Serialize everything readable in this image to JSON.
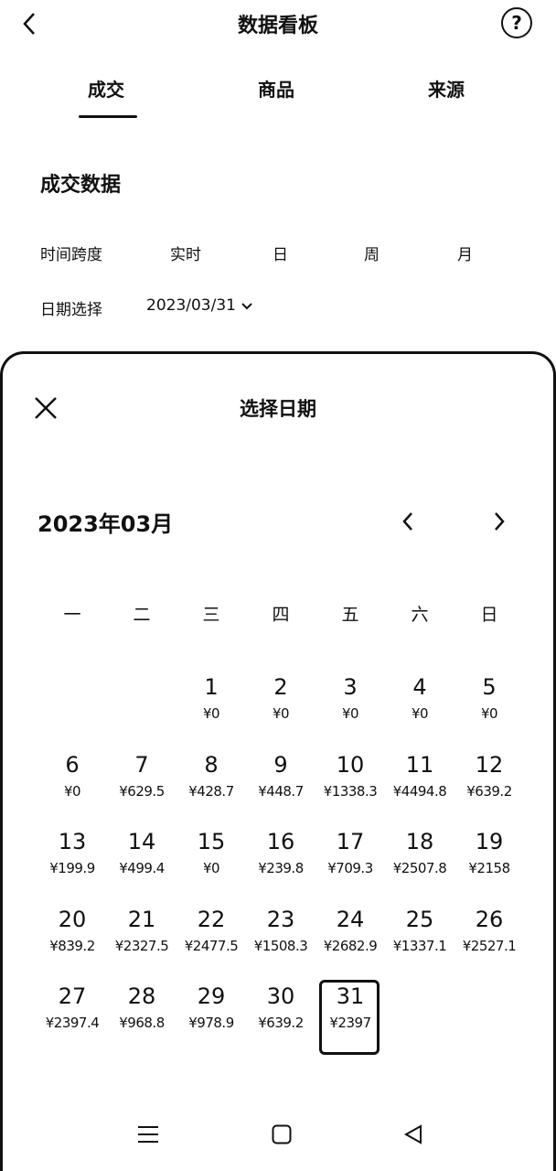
{
  "header": {
    "title": "数据看板"
  },
  "tabs": [
    {
      "label": "成交",
      "active": true
    },
    {
      "label": "商品",
      "active": false
    },
    {
      "label": "来源",
      "active": false
    }
  ],
  "section": {
    "title": "成交数据",
    "time_span_label": "时间跨度",
    "time_span_options": [
      "实时",
      "日",
      "周",
      "月"
    ],
    "date_label": "日期选择",
    "date_value": "2023/03/31"
  },
  "sheet": {
    "title": "选择日期",
    "month_label": "2023年03月",
    "weekdays": [
      "一",
      "二",
      "三",
      "四",
      "五",
      "六",
      "日"
    ],
    "selected_day": "31",
    "weeks": [
      [
        {
          "day": "",
          "amount": ""
        },
        {
          "day": "",
          "amount": ""
        },
        {
          "day": "1",
          "amount": "¥0"
        },
        {
          "day": "2",
          "amount": "¥0"
        },
        {
          "day": "3",
          "amount": "¥0"
        },
        {
          "day": "4",
          "amount": "¥0"
        },
        {
          "day": "5",
          "amount": "¥0"
        }
      ],
      [
        {
          "day": "6",
          "amount": "¥0"
        },
        {
          "day": "7",
          "amount": "¥629.5"
        },
        {
          "day": "8",
          "amount": "¥428.7"
        },
        {
          "day": "9",
          "amount": "¥448.7"
        },
        {
          "day": "10",
          "amount": "¥1338.3"
        },
        {
          "day": "11",
          "amount": "¥4494.8"
        },
        {
          "day": "12",
          "amount": "¥639.2"
        }
      ],
      [
        {
          "day": "13",
          "amount": "¥199.9"
        },
        {
          "day": "14",
          "amount": "¥499.4"
        },
        {
          "day": "15",
          "amount": "¥0"
        },
        {
          "day": "16",
          "amount": "¥239.8"
        },
        {
          "day": "17",
          "amount": "¥709.3"
        },
        {
          "day": "18",
          "amount": "¥2507.8"
        },
        {
          "day": "19",
          "amount": "¥2158"
        }
      ],
      [
        {
          "day": "20",
          "amount": "¥839.2"
        },
        {
          "day": "21",
          "amount": "¥2327.5"
        },
        {
          "day": "22",
          "amount": "¥2477.5"
        },
        {
          "day": "23",
          "amount": "¥1508.3"
        },
        {
          "day": "24",
          "amount": "¥2682.9"
        },
        {
          "day": "25",
          "amount": "¥1337.1"
        },
        {
          "day": "26",
          "amount": "¥2527.1"
        }
      ],
      [
        {
          "day": "27",
          "amount": "¥2397.4"
        },
        {
          "day": "28",
          "amount": "¥968.8"
        },
        {
          "day": "29",
          "amount": "¥978.9"
        },
        {
          "day": "30",
          "amount": "¥639.2"
        },
        {
          "day": "31",
          "amount": "¥2397"
        },
        {
          "day": "",
          "amount": ""
        },
        {
          "day": "",
          "amount": ""
        }
      ]
    ]
  },
  "icons": {
    "back": "chevron-left-icon",
    "help": "question-circle-icon",
    "close": "close-icon",
    "prev": "chevron-left-icon",
    "next": "chevron-right-icon",
    "dropdown": "chevron-down-icon",
    "nav_menu": "menu-icon",
    "nav_home": "square-icon",
    "nav_back": "triangle-back-icon"
  }
}
